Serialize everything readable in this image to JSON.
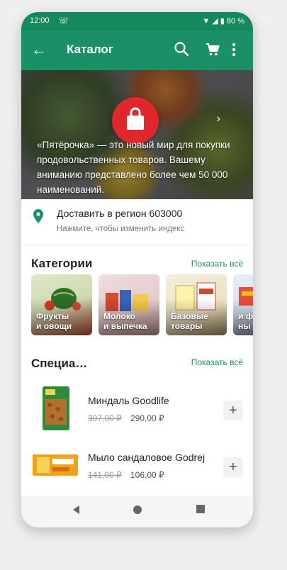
{
  "status": {
    "time": "12:00",
    "battery": "80 %"
  },
  "appbar": {
    "title": "Каталог"
  },
  "banner": {
    "text": "«Пятёрочка» — это новый мир для покупки продовольственных товаров. Вашему вниманию представлено более чем 50 000 наименований."
  },
  "delivery": {
    "title": "Доставить в регион 603000",
    "subtitle": "Нажмите, чтобы изменить индекс"
  },
  "categories": {
    "title": "Категории",
    "show_all": "Показать всё",
    "items": [
      {
        "line1": "Фрукты",
        "line2": "и овощи"
      },
      {
        "line1": "Молоко",
        "line2": "и выпечка"
      },
      {
        "line1": "Базовые",
        "line2": "товары"
      },
      {
        "line1": "",
        "line2": ""
      }
    ],
    "partial_label_1": "и ф",
    "partial_label_2": "ны"
  },
  "specials": {
    "title": "Специа…",
    "show_all": "Показать всё",
    "products": [
      {
        "name": "Миндаль Goodlife",
        "old_price": "307,00 ₽",
        "new_price": "290,00 ₽"
      },
      {
        "name": "Мыло сандаловое Godrej",
        "old_price": "141,00 ₽",
        "new_price": "106,00 ₽"
      }
    ]
  },
  "colors": {
    "brand_green": "#1b9066",
    "accent_red": "#e0272b"
  }
}
